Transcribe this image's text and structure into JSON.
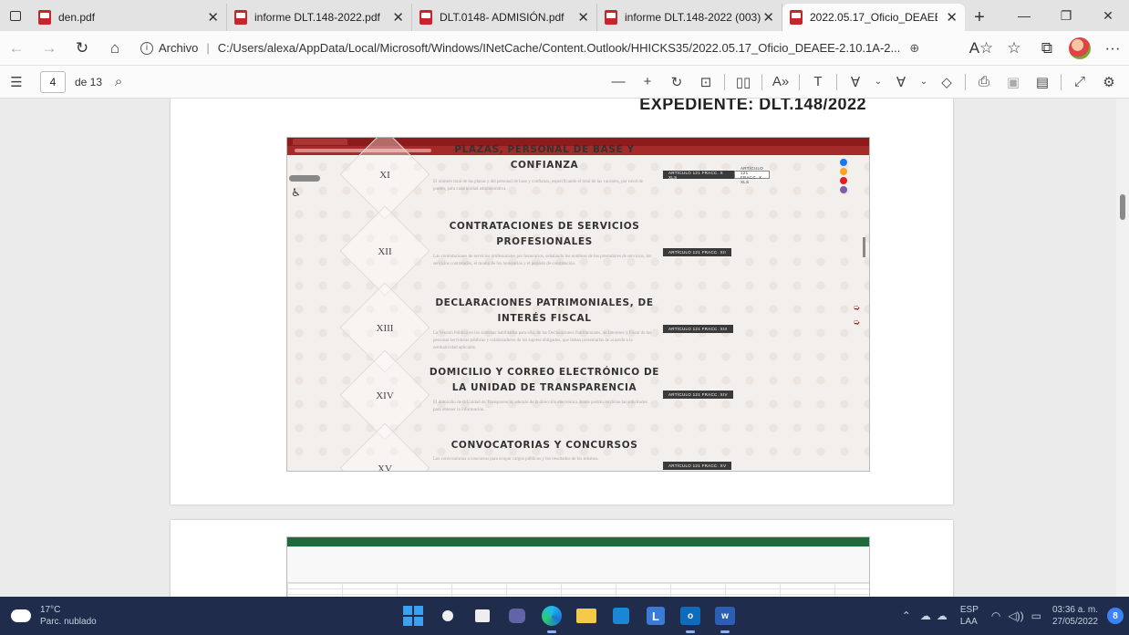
{
  "tabs": [
    {
      "title": "den.pdf",
      "active": false
    },
    {
      "title": "informe DLT.148-2022.pdf",
      "active": false
    },
    {
      "title": "DLT.0148- ADMISIÓN.pdf",
      "active": false
    },
    {
      "title": "informe DLT.148-2022 (003).pdf",
      "active": false
    },
    {
      "title": "2022.05.17_Oficio_DEAEE-2.10.1A-2...",
      "active": true
    }
  ],
  "address": {
    "scheme_label": "Archivo",
    "url": "C:/Users/alexa/AppData/Local/Microsoft/Windows/INetCache/Content.Outlook/HHICKS35/2022.05.17_Oficio_DEAEE-2.10.1A-2..."
  },
  "pdf_toolbar": {
    "page_number": "4",
    "page_count": "de 13"
  },
  "document": {
    "heading": "EXPEDIENTE: DLT.148/2022",
    "sections": [
      {
        "numeral": "XI",
        "title": "PLAZAS, PERSONAL DE BASE Y CONFIANZA",
        "description": "El número total de las plazas y del personal de base y confianza, especificando el total de las vacantes, por nivel de puesto, para cada unidad administrativa.",
        "buttons": [
          "ARTÍCULO 121 FRACC. X XLS",
          "ARTÍCULO 121 FRACC. X XLS"
        ]
      },
      {
        "numeral": "XII",
        "title": "CONTRATACIONES DE SERVICIOS PROFESIONALES",
        "description": "Las contrataciones de servicios profesionales por honorarios, señalando los nombres de los prestadores de servicios, los servicios contratados, el monto de los honorarios y el periodo de contratación.",
        "buttons": [
          "ARTÍCULO 121 FRACC. XII"
        ]
      },
      {
        "numeral": "XIII",
        "title": "DECLARACIONES PATRIMONIALES, DE INTERÉS FISCAL",
        "description": "La Versión Pública en los sistemas habilitados para ello, de las Declaraciones Patrimoniales, de Intereses y Fiscal de las personas servidoras públicas y colaboradores de los sujetos obligados, que deban presentarlas de acuerdo a la normatividad aplicable.",
        "buttons": [
          "ARTÍCULO 121 FRACC. XIII"
        ]
      },
      {
        "numeral": "XIV",
        "title": "DOMICILIO Y CORREO ELECTRÓNICO DE LA UNIDAD DE TRANSPARENCIA",
        "description": "El domicilio de la Unidad de Transparencia, además de la dirección electrónica donde podrán recibirse las solicitudes para obtener la información.",
        "buttons": [
          "ARTÍCULO 121 FRACC. XIV"
        ]
      },
      {
        "numeral": "XV",
        "title": "CONVOCATORIAS Y CONCURSOS",
        "description": "Las convocatorias a concursos para ocupar cargos públicos y los resultados de los mismos.",
        "buttons": [
          "ARTÍCULO 121 FRACC. XV"
        ]
      }
    ]
  },
  "taskbar": {
    "temperature": "17°C",
    "weather": "Parc. nublado",
    "lang_line1": "ESP",
    "lang_line2": "LAA",
    "time": "03:36 a. m.",
    "date": "27/05/2022",
    "notifications": "8"
  },
  "colors": {
    "browser_tab_bg": "#e3e3e3",
    "pdf_red": "#c4262e",
    "site_header": "#8e1b1b",
    "taskbar_bg": "#1f2c4b"
  }
}
